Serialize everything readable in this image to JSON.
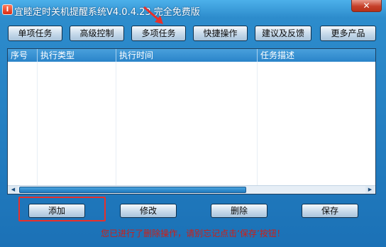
{
  "window": {
    "title": "宜睦定时关机提醒系统V4.0.4.23 完全免费版",
    "app_icon_glyph": "I",
    "close_glyph": "✕"
  },
  "toolbar": {
    "buttons": [
      "单项任务",
      "高级控制",
      "多项任务",
      "快捷操作",
      "建议及反馈",
      "更多产品"
    ]
  },
  "list": {
    "columns": [
      "序号",
      "执行类型",
      "执行时间",
      "任务描述"
    ],
    "rows": []
  },
  "scrollbar": {
    "left_glyph": "◀",
    "right_glyph": "▶"
  },
  "actions": {
    "add": "添加",
    "edit": "修改",
    "delete": "删除",
    "save": "保存"
  },
  "notice": "您已进行了删除操作，请别忘记点击‘保存’按钮！",
  "colors": {
    "accent": "#2d8ccc",
    "notice": "#d11d14",
    "highlight": "#e8302a"
  }
}
